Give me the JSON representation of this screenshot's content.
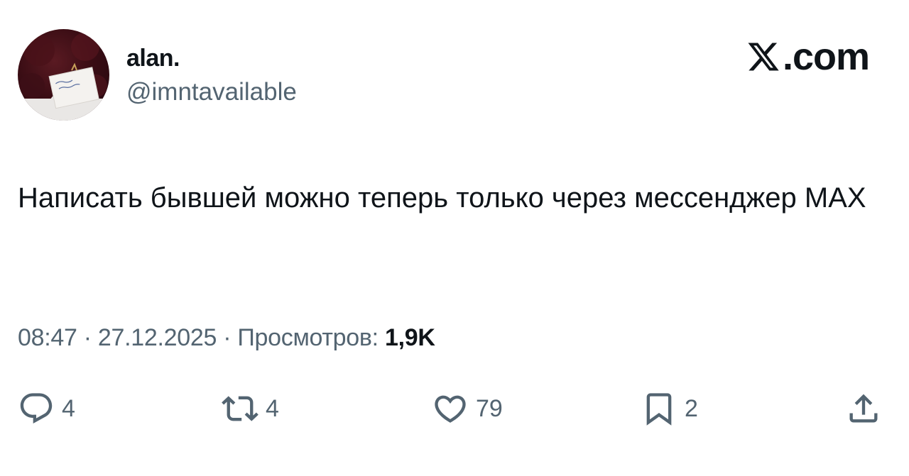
{
  "author": {
    "display_name": "alan.",
    "handle": "@imntavailable",
    "avatar_icon": "avatar-photo"
  },
  "brand": {
    "icon": "x-logo-icon",
    "label": ".com"
  },
  "tweet": {
    "text": "Написать бывшей можно теперь только через мессенджер MAX"
  },
  "meta": {
    "time": "08:47",
    "separator": " · ",
    "date": "27.12.2025",
    "views_label": "Просмотров:",
    "views_count": "1,9K"
  },
  "actions": {
    "reply": {
      "icon": "reply-icon",
      "count": "4"
    },
    "retweet": {
      "icon": "retweet-icon",
      "count": "4"
    },
    "like": {
      "icon": "heart-icon",
      "count": "79"
    },
    "bookmark": {
      "icon": "bookmark-icon",
      "count": "2"
    },
    "share": {
      "icon": "share-icon"
    }
  },
  "colors": {
    "text_primary": "#0f1419",
    "text_secondary": "#536471",
    "background": "#ffffff"
  }
}
